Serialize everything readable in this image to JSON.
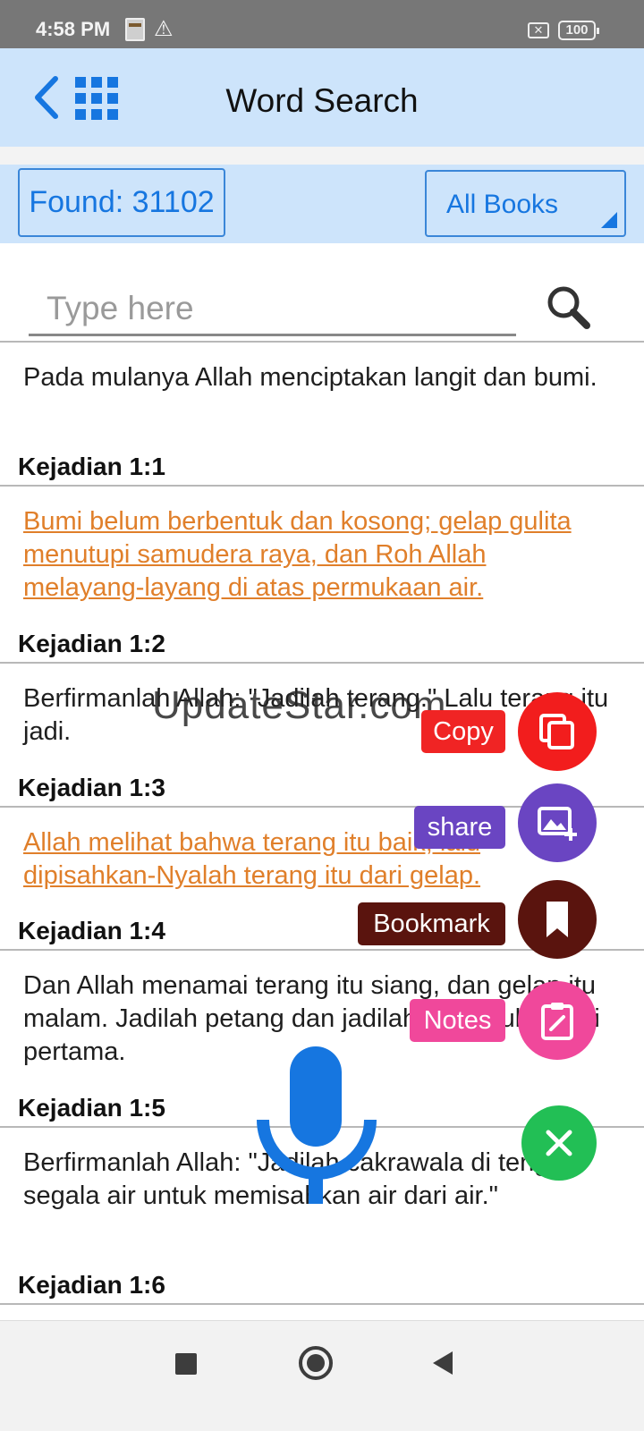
{
  "status_bar": {
    "time": "4:58 PM",
    "warning_icon": "warning-icon",
    "battery": "100"
  },
  "header": {
    "title": "Word Search",
    "back_icon": "chevron-left-icon",
    "menu_icon": "grid-icon"
  },
  "toolbar": {
    "found_label": "Found: 31102",
    "books_label": "All Books"
  },
  "search": {
    "placeholder": "Type here",
    "icon": "search-icon"
  },
  "verses": [
    {
      "text": "Pada mulanya Allah menciptakan langit dan bumi.",
      "ref": "Kejadian 1:1",
      "highlighted": false
    },
    {
      "text": "Bumi belum berbentuk dan kosong; gelap gulita menutupi samudera raya, dan Roh Allah melayang-layang di atas permukaan air.",
      "ref": "Kejadian 1:2",
      "highlighted": true
    },
    {
      "text": "Berfirmanlah Allah: \"Jadilah terang.\" Lalu terang itu jadi.",
      "ref": "Kejadian 1:3",
      "highlighted": false
    },
    {
      "text": "Allah melihat bahwa terang itu baik, lalu dipisahkan-Nyalah terang itu dari gelap.",
      "ref": "Kejadian 1:4",
      "highlighted": true
    },
    {
      "text": "Dan Allah menamai terang itu siang, dan gelap itu malam. Jadilah petang dan jadilah pagi, itulah hari pertama.",
      "ref": "Kejadian 1:5",
      "highlighted": false
    },
    {
      "text": "Berfirmanlah Allah: \"Jadilah cakrawala di tengah segala air untuk memisahkan air dari air.\"",
      "ref": "Kejadian 1:6",
      "highlighted": false
    }
  ],
  "watermark": "UpdateStar.com",
  "fab_menu": {
    "copy": {
      "label": "Copy",
      "icon": "copy-icon",
      "color": "#f21d1d"
    },
    "share": {
      "label": "share",
      "icon": "share-image-icon",
      "color": "#6a45c2"
    },
    "bookmark": {
      "label": "Bookmark",
      "icon": "bookmark-icon",
      "color": "#5a140e"
    },
    "notes": {
      "label": "Notes",
      "icon": "clipboard-edit-icon",
      "color": "#f0489b"
    },
    "close": {
      "icon": "close-icon",
      "color": "#22bf55"
    }
  },
  "mic_icon": "microphone-icon",
  "accent_color": "#1676e0",
  "highlight_color": "#e07f2a"
}
